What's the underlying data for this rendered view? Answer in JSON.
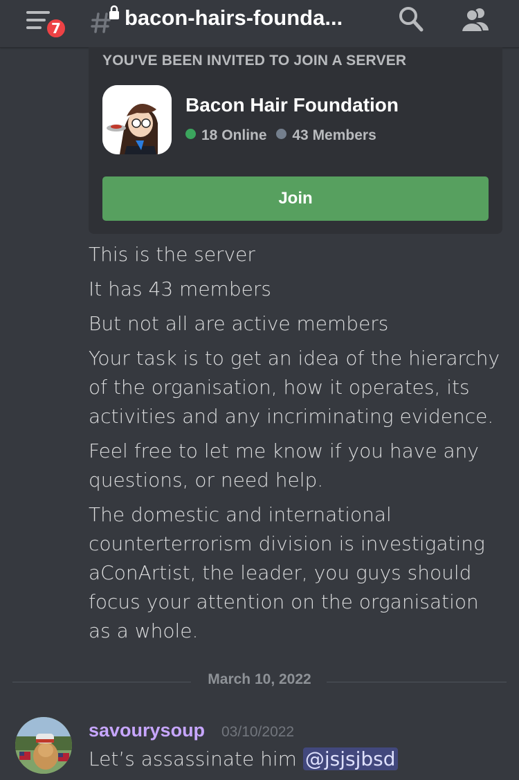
{
  "header": {
    "notification_count": "7",
    "channel_name": "bacon-hairs-founda..."
  },
  "invite": {
    "heading": "YOU'VE BEEN INVITED TO JOIN A SERVER",
    "server_name": "Bacon Hair Foundation",
    "online": "18 Online",
    "members": "43 Members",
    "join_label": "Join",
    "online_color": "#3ba55d",
    "offline_color": "#747f8d"
  },
  "messages": [
    "This is the server",
    "It has 43 members",
    "But not all are active members",
    "Your task is to get an idea of the hierarchy of the organisation, how it operates, its activities and any  incriminating evidence.",
    "Feel free to let me know if you have any questions, or need help.",
    "The domestic and international counterterrorism division is investigating aConArtist, the leader, you guys should focus your attention on the organisation as a whole."
  ],
  "date_divider": "March 10, 2022",
  "last_message": {
    "author": "savourysoup",
    "timestamp": "03/10/2022",
    "text": "Let’s assassinate him ",
    "mention": "@jsjsjbsd"
  },
  "colors": {
    "background": "#36393f",
    "card": "#2f3136",
    "join_button": "#57a05f",
    "badge": "#ed4245",
    "author": "#c7a6ff"
  }
}
